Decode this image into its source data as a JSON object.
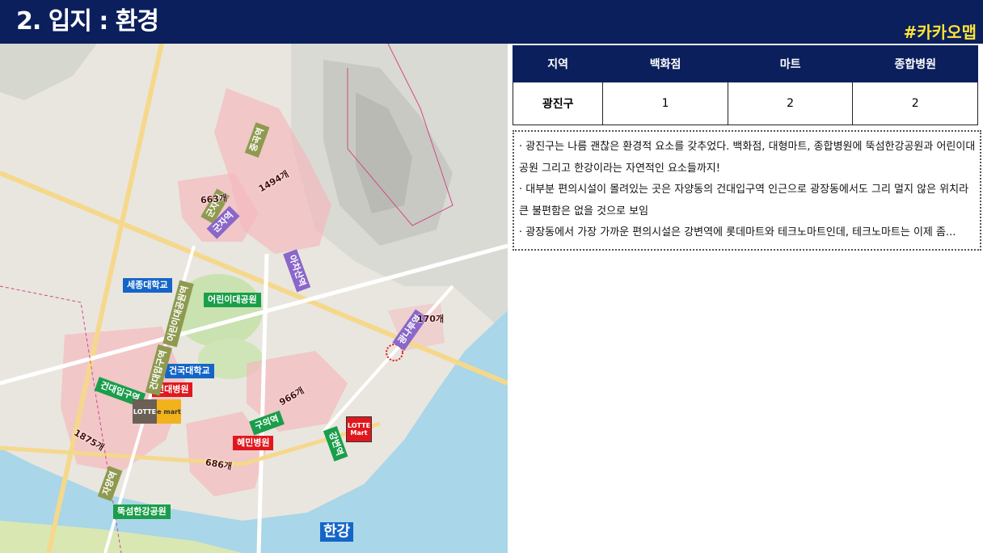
{
  "header": {
    "title": "2. 입지 : 환경",
    "tag": "#카카오맵"
  },
  "map": {
    "labels": {
      "sejong_univ": "세종대학교",
      "childrens_park": "어린이대공원",
      "konkuk_univ": "건국대학교",
      "konkuk_hospital": "건대병원",
      "hyemin_hospital": "혜민병원",
      "ttukseom_park": "뚝섬한강공원",
      "han_river": "한강"
    },
    "stations": {
      "gunja_1": "군자역",
      "gunja_2": "군자역",
      "achasan": "아차산역",
      "gwangnaru": "광나루역",
      "childrens_park_stn": "어린이대공원역",
      "konkuk_entrance_1": "건대입구역",
      "konkuk_entrance_2": "건대입구역",
      "guui": "구의역",
      "gangbyeon": "강변역",
      "jayang": "자양역"
    },
    "counts": {
      "c1": "1494개",
      "c2": "663개",
      "c3": "170개",
      "c4": "966개",
      "c5": "1875개",
      "c6": "686개",
      "c7": "중곡역"
    },
    "stores": {
      "lotte_dept": "LOTTE",
      "emart": "e mart",
      "lotte_mart": "LOTTE Mart"
    }
  },
  "table": {
    "headers": [
      "지역",
      "백화점",
      "마트",
      "종합병원"
    ],
    "rows": [
      {
        "region": "광진구",
        "dept": "1",
        "mart": "2",
        "hospital": "2"
      }
    ]
  },
  "notes": [
    "· 광진구는 나름 괜찮은 환경적 요소를 갖추었다. 백화점, 대형마트, 종합병원에 뚝섬한강공원과 어린이대공원 그리고 한강이라는 자연적인 요소들까지!",
    "· 대부분 편의시설이 몰려있는 곳은 자양동의 건대입구역 인근으로 광장동에서도 그리 멀지 않은 위치라 큰 불편함은 없을 것으로 보임",
    "· 광장동에서 가장 가까운 편의시설은 강변역에 롯데마트와 테크노마트인데, 테크노마트는 이제 좀..."
  ],
  "colors": {
    "navy": "#0b1f5c",
    "tag_yellow": "#ffe438",
    "zone_pink": "#f3b9be",
    "river_blue": "#a9d6e8"
  }
}
